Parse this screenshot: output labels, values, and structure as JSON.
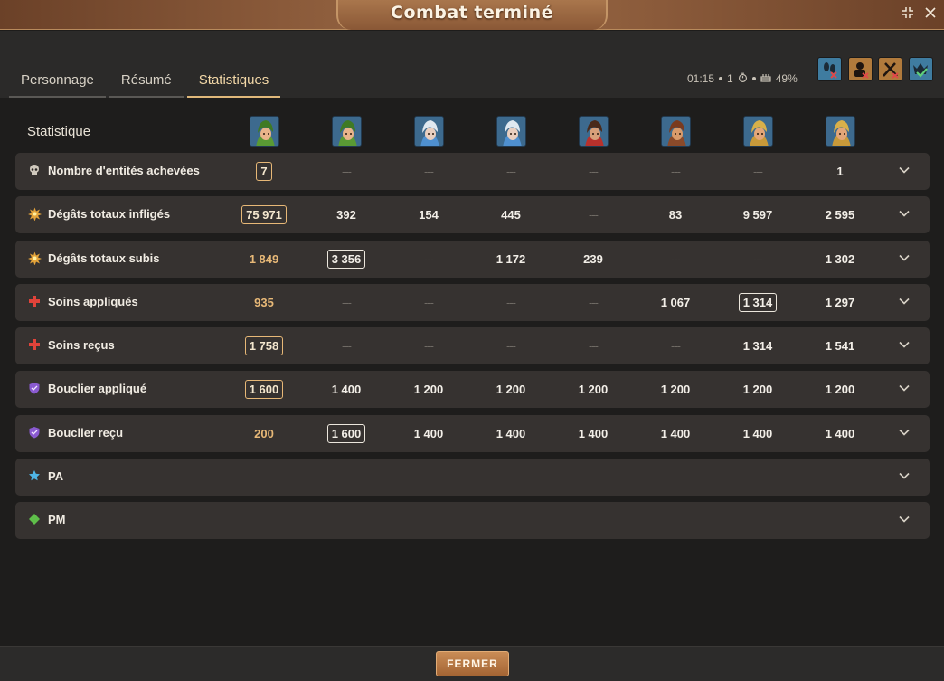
{
  "window": {
    "title": "Combat terminé",
    "collapse_icon": "collapse-arrows-icon",
    "close_icon": "close-x-icon"
  },
  "tabs": [
    {
      "label": "Personnage",
      "active": false
    },
    {
      "label": "Résumé",
      "active": false
    },
    {
      "label": "Statistiques",
      "active": true
    }
  ],
  "fight_info": {
    "duration": "01:15",
    "turns": "1",
    "turn_icon": "stopwatch-icon",
    "percentage": "49%",
    "percentage_icon": "cake-icon"
  },
  "flags": [
    {
      "icon": "footprints-lock-icon",
      "color": "#3f7ca0"
    },
    {
      "icon": "padlock-character-icon",
      "color": "#b07a3c"
    },
    {
      "icon": "swords-barrier-icon",
      "color": "#b07a3c"
    },
    {
      "icon": "monster-check-icon",
      "color": "#3f7ca0"
    }
  ],
  "table": {
    "header_label": "Statistique",
    "portraits": [
      {
        "icon": "green-hood-character-icon",
        "kind": "green"
      },
      {
        "icon": "green-hood-character-icon",
        "kind": "green"
      },
      {
        "icon": "blue-hat-character-icon",
        "kind": "blue"
      },
      {
        "icon": "blue-hat-character-icon",
        "kind": "blue"
      },
      {
        "icon": "red-hood-character-icon",
        "kind": "red"
      },
      {
        "icon": "brown-hair-character-icon",
        "kind": "brown"
      },
      {
        "icon": "yellow-hair-character-icon",
        "kind": "yellow"
      },
      {
        "icon": "yellow-hair-character-icon",
        "kind": "yellow"
      }
    ],
    "rows": [
      {
        "label": "Nombre d'entités achevées",
        "icon": "skull-icon",
        "icon_color": "#cfc8bc",
        "total": "7",
        "total_boxed": true,
        "values": [
          "---",
          "---",
          "---",
          "---",
          "---",
          "---",
          "1"
        ],
        "boxed_index": -1
      },
      {
        "label": "Dégâts totaux infligés",
        "icon": "explosion-icon",
        "icon_color": "#e4a43a",
        "total": "75 971",
        "total_boxed": true,
        "values": [
          "392",
          "154",
          "445",
          "---",
          "83",
          "9 597",
          "2 595"
        ],
        "boxed_index": -1
      },
      {
        "label": "Dégâts totaux subis",
        "icon": "explosion-icon",
        "icon_color": "#e4a43a",
        "total": "1 849",
        "total_boxed": false,
        "values": [
          "3 356",
          "---",
          "1 172",
          "239",
          "---",
          "---",
          "1 302"
        ],
        "boxed_index": 0
      },
      {
        "label": "Soins appliqués",
        "icon": "heal-cross-icon",
        "icon_color": "#e0433a",
        "total": "935",
        "total_boxed": false,
        "values": [
          "---",
          "---",
          "---",
          "---",
          "1 067",
          "1 314",
          "1 297"
        ],
        "boxed_index": 5
      },
      {
        "label": "Soins reçus",
        "icon": "heal-cross-icon",
        "icon_color": "#e0433a",
        "total": "1 758",
        "total_boxed": true,
        "values": [
          "---",
          "---",
          "---",
          "---",
          "---",
          "1 314",
          "1 541"
        ],
        "boxed_index": -1
      },
      {
        "label": "Bouclier appliqué",
        "icon": "shield-icon",
        "icon_color": "#8a5ad0",
        "total": "1 600",
        "total_boxed": true,
        "values": [
          "1 400",
          "1 200",
          "1 200",
          "1 200",
          "1 200",
          "1 200",
          "1 200"
        ],
        "boxed_index": -1
      },
      {
        "label": "Bouclier reçu",
        "icon": "shield-icon",
        "icon_color": "#8a5ad0",
        "total": "200",
        "total_boxed": false,
        "values": [
          "1 600",
          "1 400",
          "1 400",
          "1 400",
          "1 400",
          "1 400",
          "1 400"
        ],
        "boxed_index": 0
      },
      {
        "label": "PA",
        "icon": "star-icon",
        "icon_color": "#4fb6e6",
        "total": "",
        "total_boxed": false,
        "values": [],
        "boxed_index": -1
      },
      {
        "label": "PM",
        "icon": "diamond-icon",
        "icon_color": "#5fbf4a",
        "total": "",
        "total_boxed": false,
        "values": [],
        "boxed_index": -1
      }
    ],
    "expand_icon": "chevron-down-icon"
  },
  "footer": {
    "close_label": "FERMER"
  }
}
